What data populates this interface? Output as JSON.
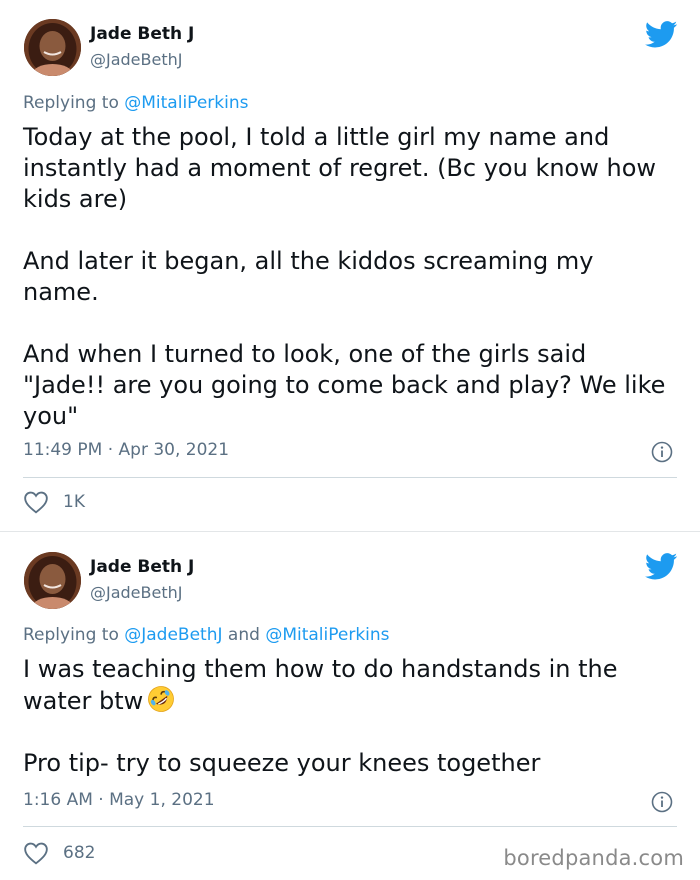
{
  "colors": {
    "link": "#1d9bf0",
    "secondary_text": "#5b7083",
    "text": "#0f1419"
  },
  "tweets": [
    {
      "author": {
        "name": "Jade Beth J",
        "handle": "@JadeBethJ"
      },
      "reply": {
        "prefix": "Replying to",
        "mentions": [
          "@MitaliPerkins"
        ],
        "joiner": ""
      },
      "paragraphs": [
        "Today at the pool, I told a little girl my name and instantly had a moment of regret. (Bc you know how kids are)",
        "And later it began,  all the kiddos screaming my name.",
        "And when I turned to look,  one of the girls said \"Jade!! are you going to come back and play? We like you\""
      ],
      "timestamp": "11:49 PM · Apr 30, 2021",
      "likes": "1K",
      "icons": {
        "brand": "twitter-bird-icon",
        "info": "info-icon",
        "like": "heart-icon"
      }
    },
    {
      "author": {
        "name": "Jade Beth J",
        "handle": "@JadeBethJ"
      },
      "reply": {
        "prefix": "Replying to",
        "mentions": [
          "@JadeBethJ",
          "@MitaliPerkins"
        ],
        "joiner": "and"
      },
      "paragraphs": [
        "I was teaching them how to do handstands in the water btw",
        "Pro tip- try to squeeze your knees together"
      ],
      "emoji": "rolling-on-floor-laughing-icon",
      "timestamp": "1:16 AM · May 1, 2021",
      "likes": "682",
      "icons": {
        "brand": "twitter-bird-icon",
        "info": "info-icon",
        "like": "heart-icon"
      }
    }
  ],
  "watermark": "boredpanda.com"
}
